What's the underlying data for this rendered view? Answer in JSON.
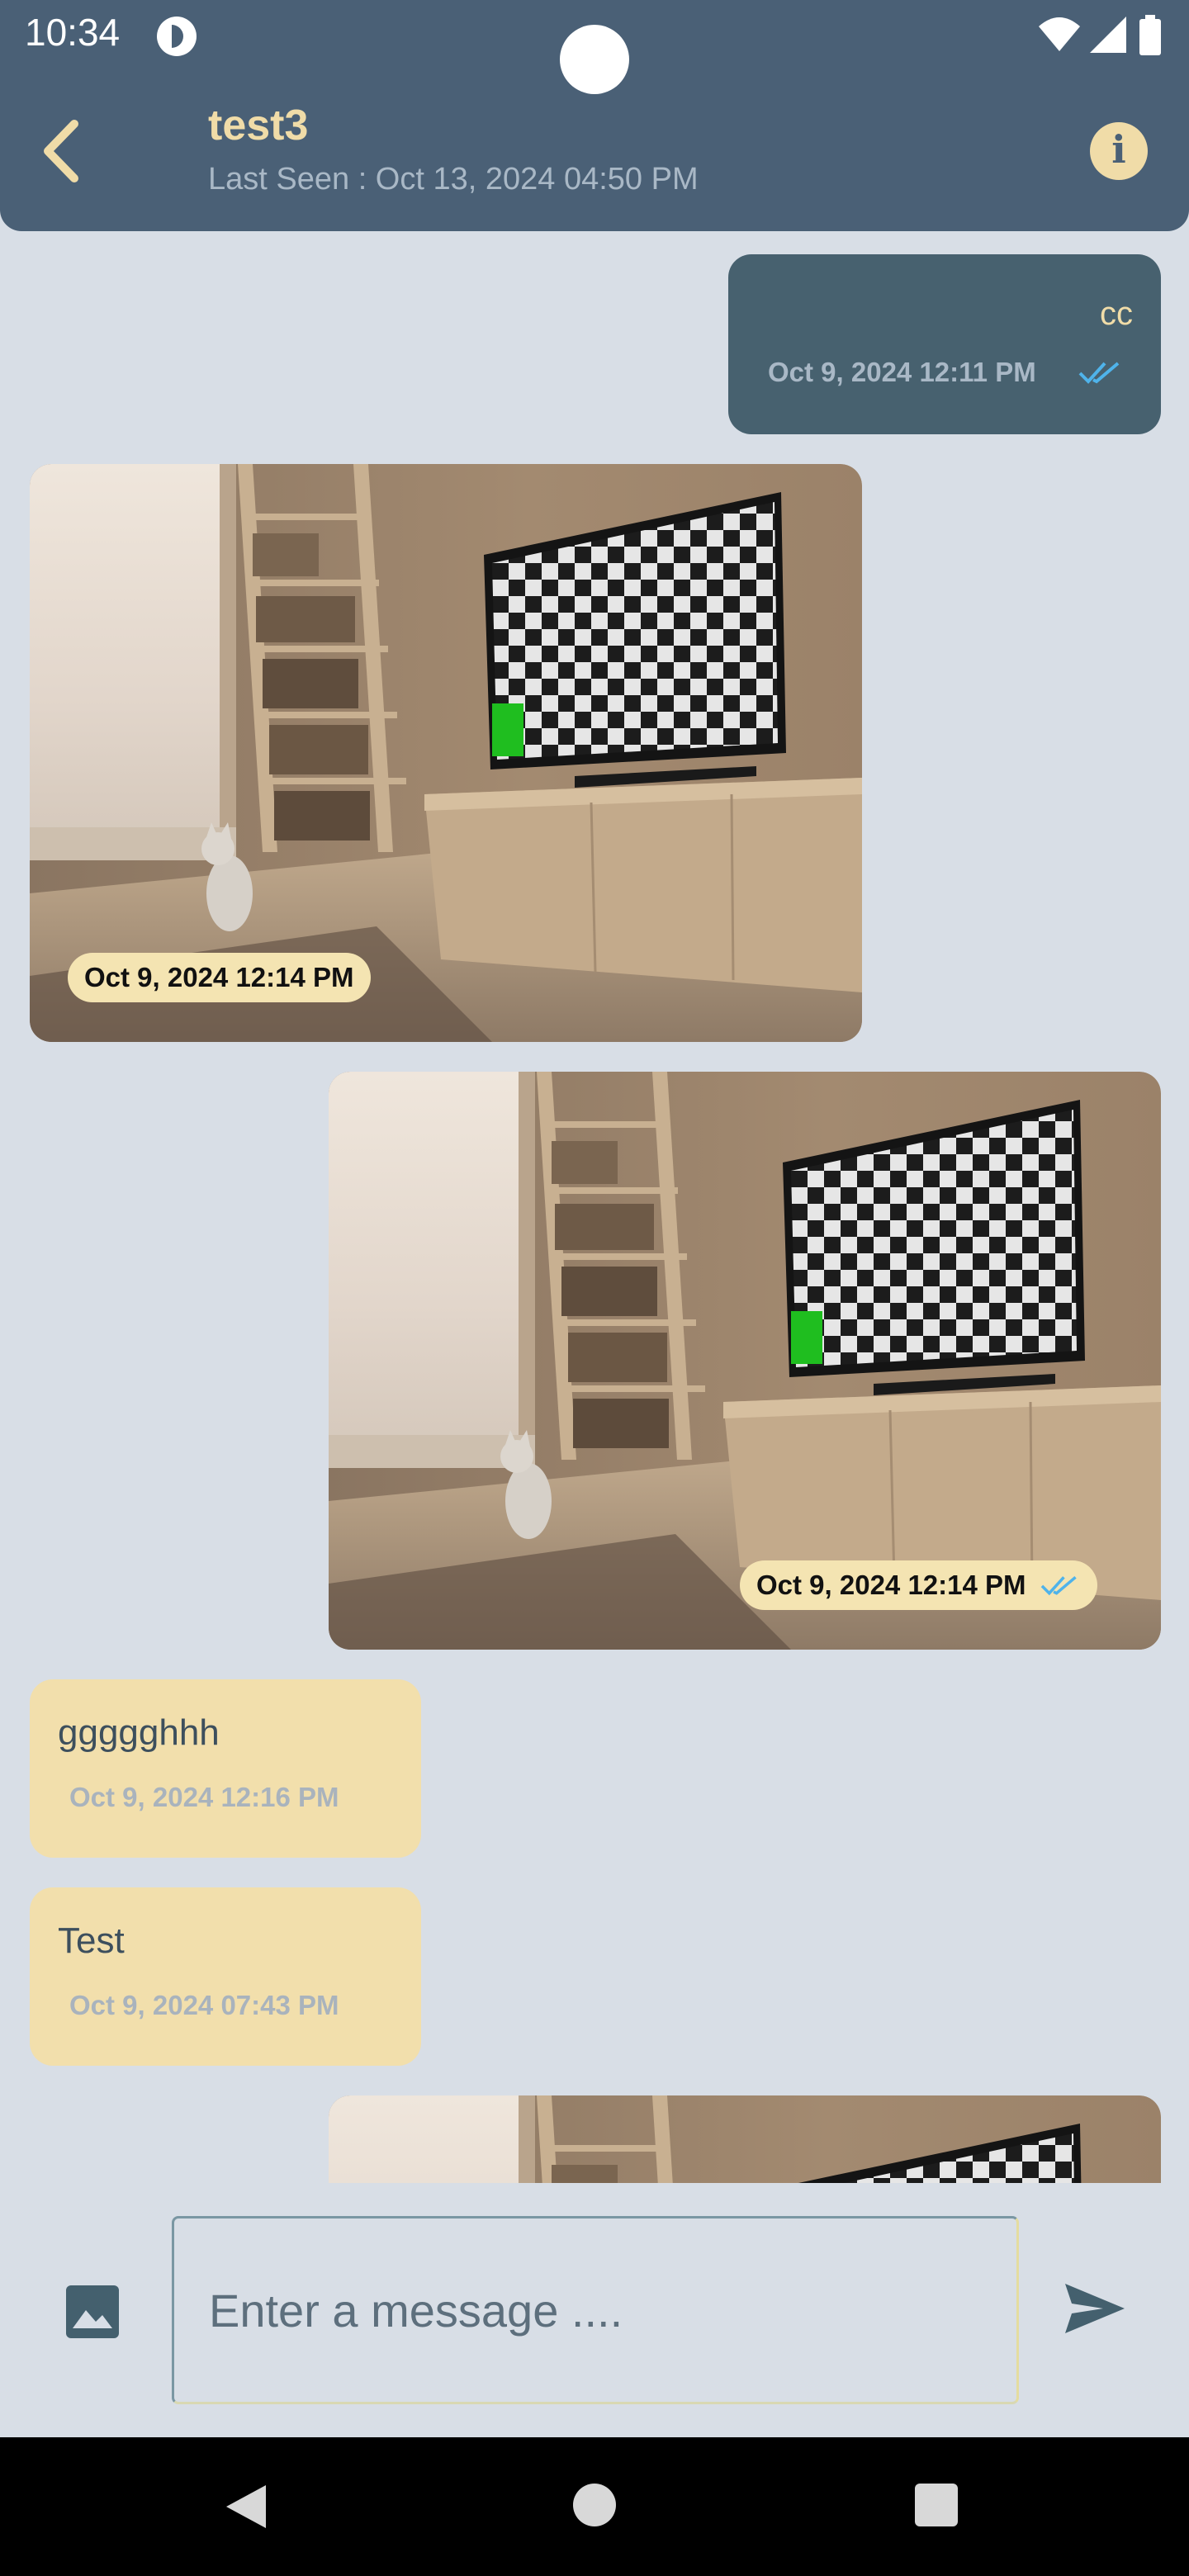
{
  "status_bar": {
    "time": "10:34"
  },
  "header": {
    "title": "test3",
    "last_seen": "Last Seen : Oct 13, 2024 04:50 PM",
    "accent_color": "#f0dca8",
    "background_color": "#4a6076",
    "back_icon": "chevron-left-icon",
    "info_icon": "info-icon",
    "info_glyph": "i"
  },
  "messages": [
    {
      "direction": "outgoing",
      "kind": "text",
      "text": "cc",
      "time": "Oct 9, 2024 12:11 PM",
      "status": "read"
    },
    {
      "direction": "incoming",
      "kind": "image",
      "time": "Oct 9, 2024 12:14 PM"
    },
    {
      "direction": "outgoing",
      "kind": "image",
      "time": "Oct 9, 2024 12:14 PM",
      "status": "read"
    },
    {
      "direction": "incoming",
      "kind": "text",
      "text": "ggggghhh",
      "time": "Oct 9, 2024 12:16 PM"
    },
    {
      "direction": "incoming",
      "kind": "text",
      "text": "Test",
      "time": "Oct 9, 2024 07:43 PM"
    },
    {
      "direction": "outgoing",
      "kind": "image",
      "time": ""
    }
  ],
  "composer": {
    "placeholder": "Enter a message ....",
    "gallery_icon": "image-icon",
    "send_icon": "send-icon"
  },
  "navigation_bar": {
    "icons": [
      "back-triangle-icon",
      "home-circle-icon",
      "recents-square-icon"
    ]
  },
  "colors": {
    "outgoing_bubble": "#47616f",
    "incoming_bubble": "#f2dfac",
    "read_ticks": "#4fb3ea",
    "chat_background": "#d8dee6"
  }
}
